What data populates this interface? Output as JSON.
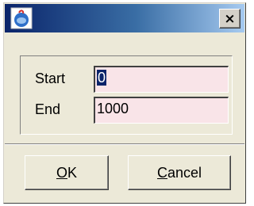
{
  "window": {
    "title": "",
    "icon": "java-app-icon",
    "close_icon": "close-x-icon",
    "close_label": "×"
  },
  "form": {
    "start": {
      "label": "Start",
      "value": "0"
    },
    "end": {
      "label": "End",
      "value": "1000"
    }
  },
  "buttons": {
    "ok": {
      "mnemonic": "O",
      "rest": "K"
    },
    "cancel": {
      "mnemonic": "C",
      "rest": "ancel"
    }
  },
  "colors": {
    "field_background": "#f9e4e8",
    "selection": "#0a246a",
    "dialog_background": "#ece9d8"
  }
}
